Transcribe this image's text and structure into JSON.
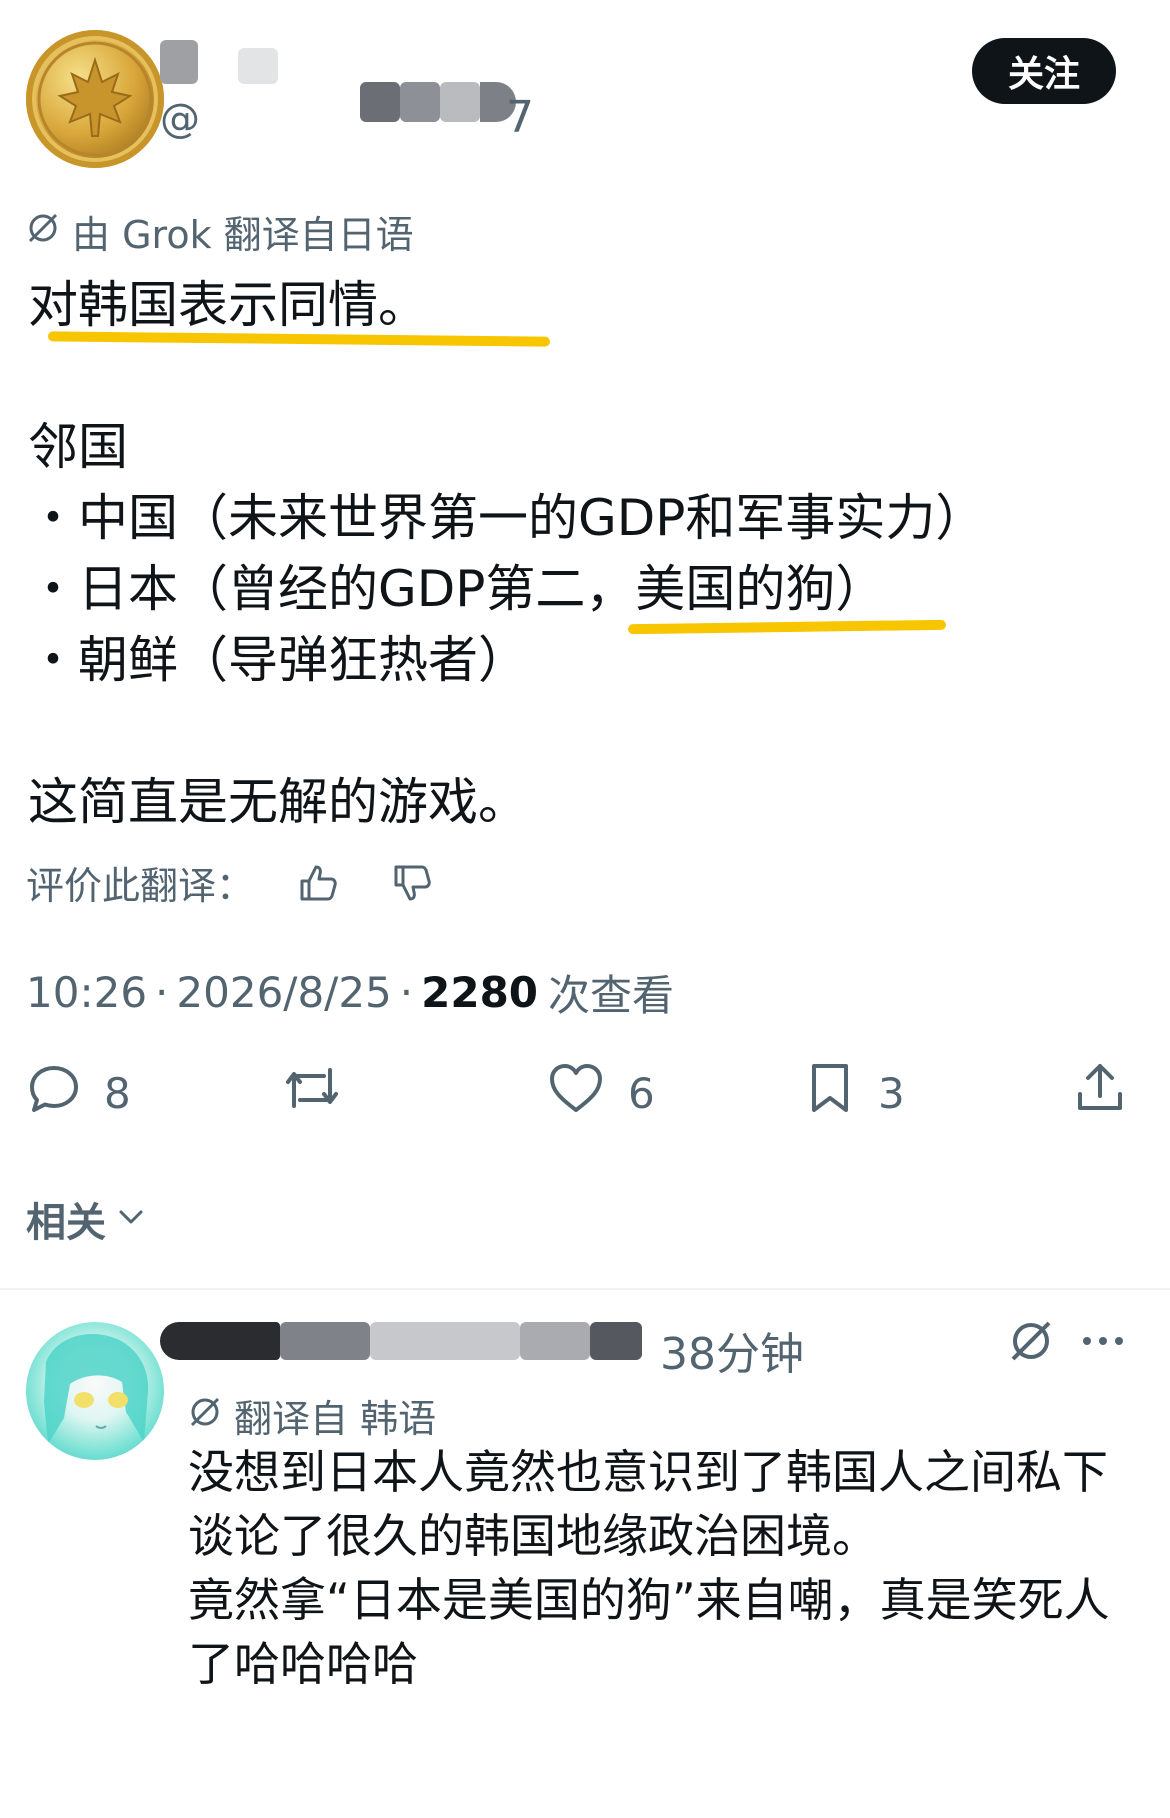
{
  "header": {
    "handle_prefix": "@",
    "handle_suffix": "7",
    "follow_label": "关注"
  },
  "post": {
    "translation_label": "由 Grok 翻译自日语",
    "lines": [
      "对韩国表示同情。",
      "",
      "邻国",
      "・中国（未来世界第一的GDP和军事实力）",
      "・日本（曾经的GDP第二，美国的狗）",
      "・朝鲜（导弹狂热者）",
      "",
      "这简直是无解的游戏。"
    ],
    "rate_label": "评价此翻译：",
    "time": "10:26",
    "date": "2026/8/25",
    "separator": "·",
    "views_count": "2280",
    "views_label": "次查看",
    "actions": {
      "reply_count": "8",
      "like_count": "6",
      "bookmark_count": "3"
    },
    "related_label": "相关"
  },
  "reply": {
    "time": "38分钟",
    "translation_label": "翻译自 韩语",
    "lines": [
      "没想到日本人竟然也意识到了韩国人之间私下",
      "谈论了很久的韩国地缘政治困境。",
      "竟然拿“日本是美国的狗”来自嘲，真是笑死人",
      "了哈哈哈哈"
    ]
  },
  "colors": {
    "text": "#0f1419",
    "secondary": "#536471",
    "highlight": "#f7c600",
    "divider": "#eff3f4"
  },
  "icons": [
    "grok-translate-icon",
    "thumbs-up-icon",
    "thumbs-down-icon",
    "reply-icon",
    "retweet-icon",
    "like-icon",
    "bookmark-icon",
    "share-icon",
    "chevron-down-icon",
    "more-icon"
  ]
}
